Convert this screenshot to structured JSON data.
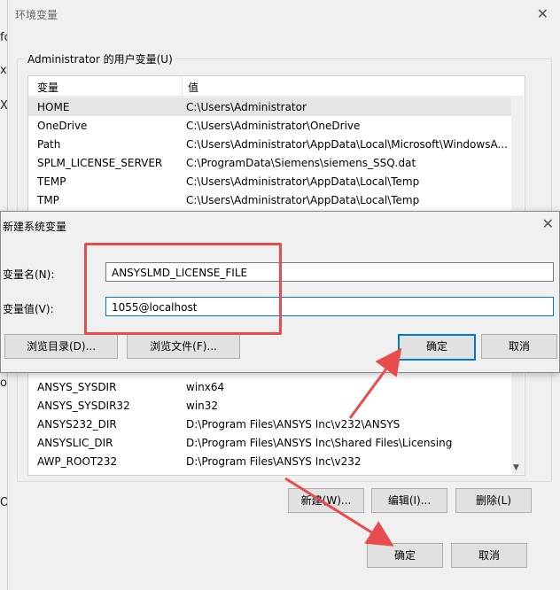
{
  "background": {
    "fragments": [
      "fc",
      "xt",
      "X",
      "ol",
      "O"
    ]
  },
  "env_dialog": {
    "title": "环境变量",
    "close_glyph": "✕",
    "user_vars_label": "Administrator 的用户变量(U)",
    "columns": [
      "变量",
      "值"
    ],
    "rows": [
      {
        "name": "HOME",
        "value": "C:\\Users\\Administrator"
      },
      {
        "name": "OneDrive",
        "value": "C:\\Users\\Administrator\\OneDrive"
      },
      {
        "name": "Path",
        "value": "C:\\Users\\Administrator\\AppData\\Local\\Microsoft\\WindowsA..."
      },
      {
        "name": "SPLM_LICENSE_SERVER",
        "value": "C:\\ProgramData\\Siemens\\siemens_SSQ.dat"
      },
      {
        "name": "TEMP",
        "value": "C:\\Users\\Administrator\\AppData\\Local\\Temp"
      },
      {
        "name": "TMP",
        "value": "C:\\Users\\Administrator\\AppData\\Local\\Temp"
      }
    ],
    "system_rows": [
      {
        "name": "ANSYS_SYSDIR",
        "value": "winx64"
      },
      {
        "name": "ANSYS_SYSDIR32",
        "value": "win32"
      },
      {
        "name": "ANSYS232_DIR",
        "value": "D:\\Program Files\\ANSYS Inc\\v232\\ANSYS"
      },
      {
        "name": "ANSYSLIC_DIR",
        "value": "D:\\Program Files\\ANSYS Inc\\Shared Files\\Licensing"
      },
      {
        "name": "AWP_ROOT232",
        "value": "D:\\Program Files\\ANSYS Inc\\v232"
      }
    ],
    "buttons": {
      "new": "新建(W)...",
      "edit": "编辑(I)...",
      "delete": "删除(L)",
      "ok": "确定",
      "cancel": "取消"
    }
  },
  "new_var_dialog": {
    "title": "新建系统变量",
    "close_glyph": "✕",
    "name_label": "变量名(N):",
    "name_value": "ANSYSLMD_LICENSE_FILE",
    "value_label": "变量值(V):",
    "value_value": "1055@localhost",
    "buttons": {
      "browse_dir": "浏览目录(D)...",
      "browse_file": "浏览文件(F)...",
      "ok": "确定",
      "cancel": "取消"
    }
  },
  "annotation_color": "#e84c4c"
}
